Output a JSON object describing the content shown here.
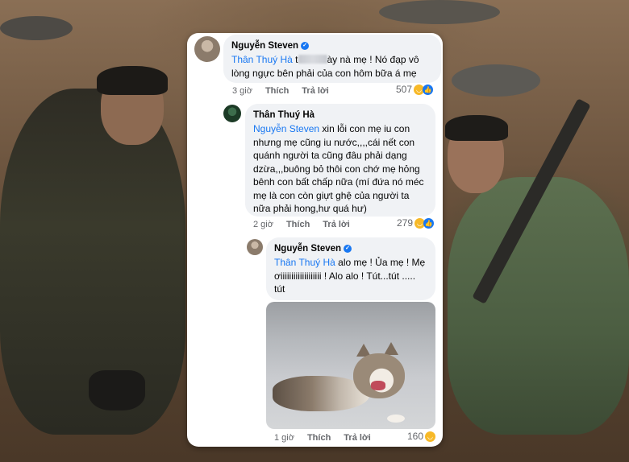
{
  "comments": [
    {
      "author": "Nguyễn Steven",
      "verified_mark": "✓",
      "mention": "Thân Thuý Hà",
      "text_a": " t",
      "text_b": "ày nà mẹ ! Nó đạp vô lòng ngực bên phải của con hôm bữa á mẹ",
      "time": "3 giờ",
      "like_label": "Thích",
      "reply_label": "Trả lời",
      "reaction_count": "507"
    },
    {
      "author": "Thân Thuý Hà",
      "mention": "Nguyễn Steven",
      "text": " xin lỗi con mẹ iu con nhưng mẹ cũng iu nước,,,,cái nết con quánh người ta cũng đâu phải dạng dzừa,,,buông bỏ thôi con chớ mẹ hỏng bênh con bất chấp nữa (mí đứa nó méc mẹ là con còn giựt ghệ của người ta nữa phải hong,hư quá hư)",
      "time": "2 giờ",
      "like_label": "Thích",
      "reply_label": "Trả lời",
      "reaction_count": "279"
    },
    {
      "author": "Nguyễn Steven",
      "verified_mark": "✓",
      "mention": "Thân Thuý Hà",
      "text": " alo mẹ ! Ủa mẹ ! Mẹ ơiiiiiiiiiiiiiiiiiii ! Alo alo ! Tút...tút ..... tút",
      "time": "1 giờ",
      "like_label": "Thích",
      "reply_label": "Trả lời",
      "reaction_count": "160"
    }
  ],
  "icons": {
    "haha": "haha-reaction-icon",
    "like": "like-reaction-icon"
  },
  "colors": {
    "mention": "#1877f2",
    "bubble": "#f0f2f5",
    "meta": "#65676b"
  }
}
